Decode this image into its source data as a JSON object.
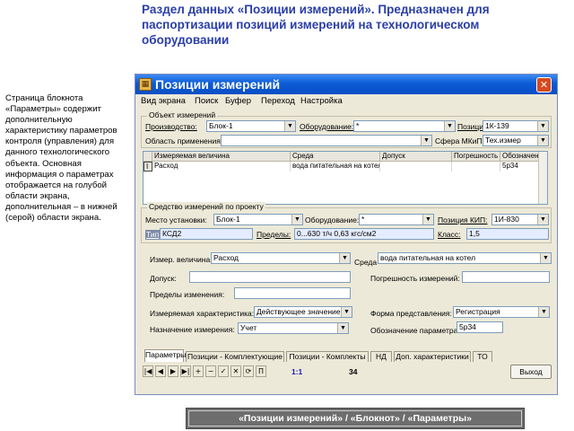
{
  "slide": {
    "title": "Раздел данных «Позиции измерений». Предназначен для паспортизации позиций измерений на технологическом оборудовании",
    "side_text": "Страница блокнота «Параметры» содержит дополнительную характеристику параметров контроля (управления) для данного технологического объекта. Основная информация о параметрах отображается на голубой области экрана, дополнительная – в нижней (серой) области экрана.",
    "caption": "«Позиции измерений» / «Блокнот» / «Параметры»"
  },
  "window": {
    "title": "Позиции измерений",
    "close_glyph": "✕"
  },
  "menu": [
    "Вид экрана",
    "Поиск",
    "Буфер",
    "Переход",
    "Настройка"
  ],
  "object_group": {
    "title": "Объект измерений",
    "production_label": "Производство:",
    "production_value": "Блок-1",
    "equipment_label": "Оборудование:",
    "equipment_value": "*",
    "position_label": "Позиция:",
    "position_value": "1К-139",
    "area_label": "Область применения:",
    "area_value": "",
    "mkit_label": "Сфера МКиП:",
    "mkit_value": "Тех.измер"
  },
  "grid": {
    "columns": [
      "Измеряемая величина",
      "Среда",
      "Допуск",
      "Погрешность",
      "Обозначени"
    ],
    "row": {
      "marker": "I",
      "quantity": "Расход",
      "medium": "вода питательная на котел",
      "tolerance": "",
      "error": "",
      "designation": "5p34"
    }
  },
  "project_group": {
    "title": "Средство измерений по проекту",
    "install_label": "Место установки:",
    "install_value": "Блок-1",
    "equipment_label": "Оборудование:",
    "equipment_value": "*",
    "kip_label": "Позиция КИП:",
    "kip_value": "1И-830",
    "type_label": "Тип",
    "type_value": "КСД2",
    "limits_label": "Пределы:",
    "limits_value": "0...630 т/ч 0,63 кгс/см2",
    "class_label": "Класс:",
    "class_value": "1,5"
  },
  "params": {
    "quantity_label": "Измер. величина:",
    "quantity_value": "Расход",
    "medium_label": "Среда",
    "medium_value": "вода питательная на котел",
    "tolerance_label": "Допуск:",
    "tolerance_value": "",
    "error_label": "Погрешность измерений:",
    "error_value": "",
    "limits_label": "Пределы изменения:",
    "limits_value": "",
    "char_label": "Измеряемая характеристика:",
    "char_value": "Действующее значение",
    "form_label": "Форма представления:",
    "form_value": "Регистрация",
    "purpose_label": "Назначение измерения:",
    "purpose_value": "Учет",
    "designation_label": "Обозначение параметра:",
    "designation_value": "5p34"
  },
  "tabs": [
    "Параметры",
    "Позиции - Комплектующие",
    "Позиции - Комплекты",
    "НД",
    "Доп. характеристики",
    "ТО"
  ],
  "navigator": {
    "buttons": [
      "|◀",
      "◀",
      "▶",
      "▶|",
      "+",
      "−",
      "✓",
      "✕",
      "⟳",
      "П"
    ],
    "record_label": "1:1",
    "count": "34",
    "exit_label": "Выход"
  },
  "colors": {
    "title_text": "#2a3ea8",
    "info_area": "#e4ecff",
    "window_bg": "#ece9d8",
    "titlebar": "#0b5bd6"
  }
}
